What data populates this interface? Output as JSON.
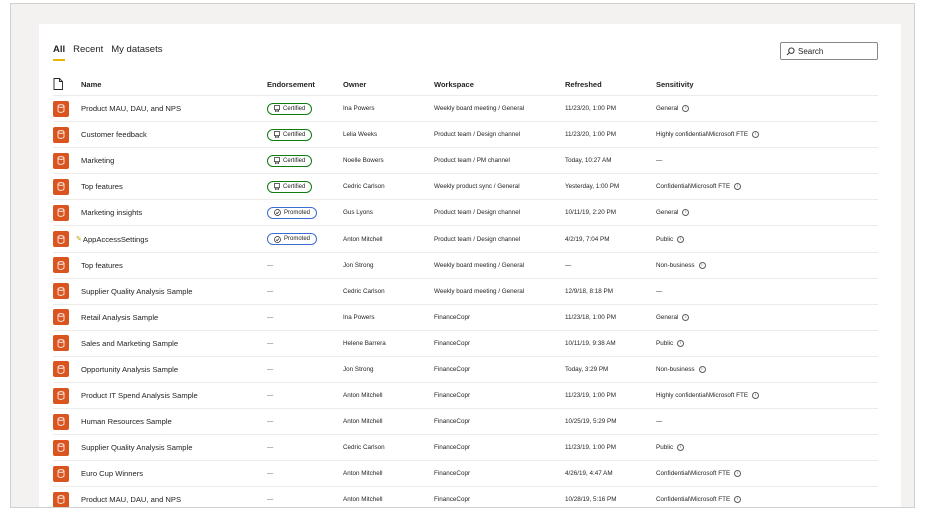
{
  "tabs": [
    {
      "label": "All",
      "active": true
    },
    {
      "label": "Recent",
      "active": false
    },
    {
      "label": "My datasets",
      "active": false
    }
  ],
  "search": {
    "placeholder": "Search"
  },
  "columns": {
    "file_icon": "file-icon",
    "name": "Name",
    "endorsement": "Endorsement",
    "owner": "Owner",
    "workspace": "Workspace",
    "refreshed": "Refreshed",
    "sensitivity": "Sensitivity"
  },
  "colors": {
    "dataset_icon": "#d9541e",
    "certified": "#107c10",
    "promoted": "#3b6fcf",
    "active_tab": "#e8b400"
  },
  "rows": [
    {
      "name": "Product MAU, DAU, and NPS",
      "endorsement": "Certified",
      "owner": "Ina Powers",
      "workspace": "Weekly board meeting / General",
      "refreshed": "11/23/20, 1:00 PM",
      "sensitivity": "General",
      "info": true
    },
    {
      "name": "Customer feedback",
      "endorsement": "Certified",
      "owner": "Lelia Weeks",
      "workspace": "Product team / Design channel",
      "refreshed": "11/23/20, 1:00 PM",
      "sensitivity": "Highly confidential\\Microsoft FTE",
      "info": true
    },
    {
      "name": "Marketing",
      "endorsement": "Certified",
      "owner": "Noelle Bowers",
      "workspace": "Product team / PM channel",
      "refreshed": "Today, 10:27 AM",
      "sensitivity": "—",
      "info": false
    },
    {
      "name": "Top features",
      "endorsement": "Certified",
      "owner": "Cedric Carlson",
      "workspace": "Weekly product sync / General",
      "refreshed": "Yesterday, 1:00 PM",
      "sensitivity": "Confidential\\Microsoft FTE",
      "info": true
    },
    {
      "name": "Marketing insights",
      "endorsement": "Promoted",
      "owner": "Gus Lyons",
      "workspace": "Product team / Design channel",
      "refreshed": "10/11/19, 2:20 PM",
      "sensitivity": "General",
      "info": true
    },
    {
      "name": "AppAccessSettings",
      "endorsement": "Promoted",
      "owner": "Anton Mitchell",
      "workspace": "Product team / Design channel",
      "refreshed": "4/2/19, 7:04 PM",
      "sensitivity": "Public",
      "info": true,
      "edited": true
    },
    {
      "name": "Top features",
      "endorsement": "—",
      "owner": "Jon Strong",
      "workspace": "Weekly board meeting / General",
      "refreshed": "—",
      "sensitivity": "Non-business",
      "info": true
    },
    {
      "name": "Supplier Quality Analysis Sample",
      "endorsement": "—",
      "owner": "Cedric Carlson",
      "workspace": "Weekly board meeting / General",
      "refreshed": "12/9/18, 8:18 PM",
      "sensitivity": "—",
      "info": false
    },
    {
      "name": "Retail Analysis Sample",
      "endorsement": "—",
      "owner": "Ina Powers",
      "workspace": "FinanceCopr",
      "refreshed": "11/23/18, 1:00 PM",
      "sensitivity": "General",
      "info": true
    },
    {
      "name": "Sales and Marketing Sample",
      "endorsement": "—",
      "owner": "Helene Barrera",
      "workspace": "FinanceCopr",
      "refreshed": "10/11/19, 9:38 AM",
      "sensitivity": "Public",
      "info": true
    },
    {
      "name": "Opportunity Analysis Sample",
      "endorsement": "—",
      "owner": "Jon Strong",
      "workspace": "FinanceCopr",
      "refreshed": "Today, 3:29 PM",
      "sensitivity": "Non-business",
      "info": true
    },
    {
      "name": "Product IT Spend Analysis Sample",
      "endorsement": "—",
      "owner": "Anton Mitchell",
      "workspace": "FinanceCopr",
      "refreshed": "11/23/19, 1:00 PM",
      "sensitivity": "Highly confidential\\Microsoft FTE",
      "info": true
    },
    {
      "name": "Human Resources Sample",
      "endorsement": "—",
      "owner": "Anton Mitchell",
      "workspace": "FinanceCopr",
      "refreshed": "10/25/19, 5:29 PM",
      "sensitivity": "—",
      "info": false
    },
    {
      "name": "Supplier Quality Analysis Sample",
      "endorsement": "—",
      "owner": "Cedric Carlson",
      "workspace": "FinanceCopr",
      "refreshed": "11/23/19, 1:00 PM",
      "sensitivity": "Public",
      "info": true
    },
    {
      "name": "Euro Cup Winners",
      "endorsement": "—",
      "owner": "Anton Mitchell",
      "workspace": "FinanceCopr",
      "refreshed": "4/26/19, 4:47 AM",
      "sensitivity": "Confidential\\Microsoft FTE",
      "info": true
    },
    {
      "name": "Product MAU, DAU, and NPS",
      "endorsement": "—",
      "owner": "Anton Mitchell",
      "workspace": "FinanceCopr",
      "refreshed": "10/28/19, 5:16 PM",
      "sensitivity": "Confidential\\Microsoft FTE",
      "info": true
    }
  ]
}
